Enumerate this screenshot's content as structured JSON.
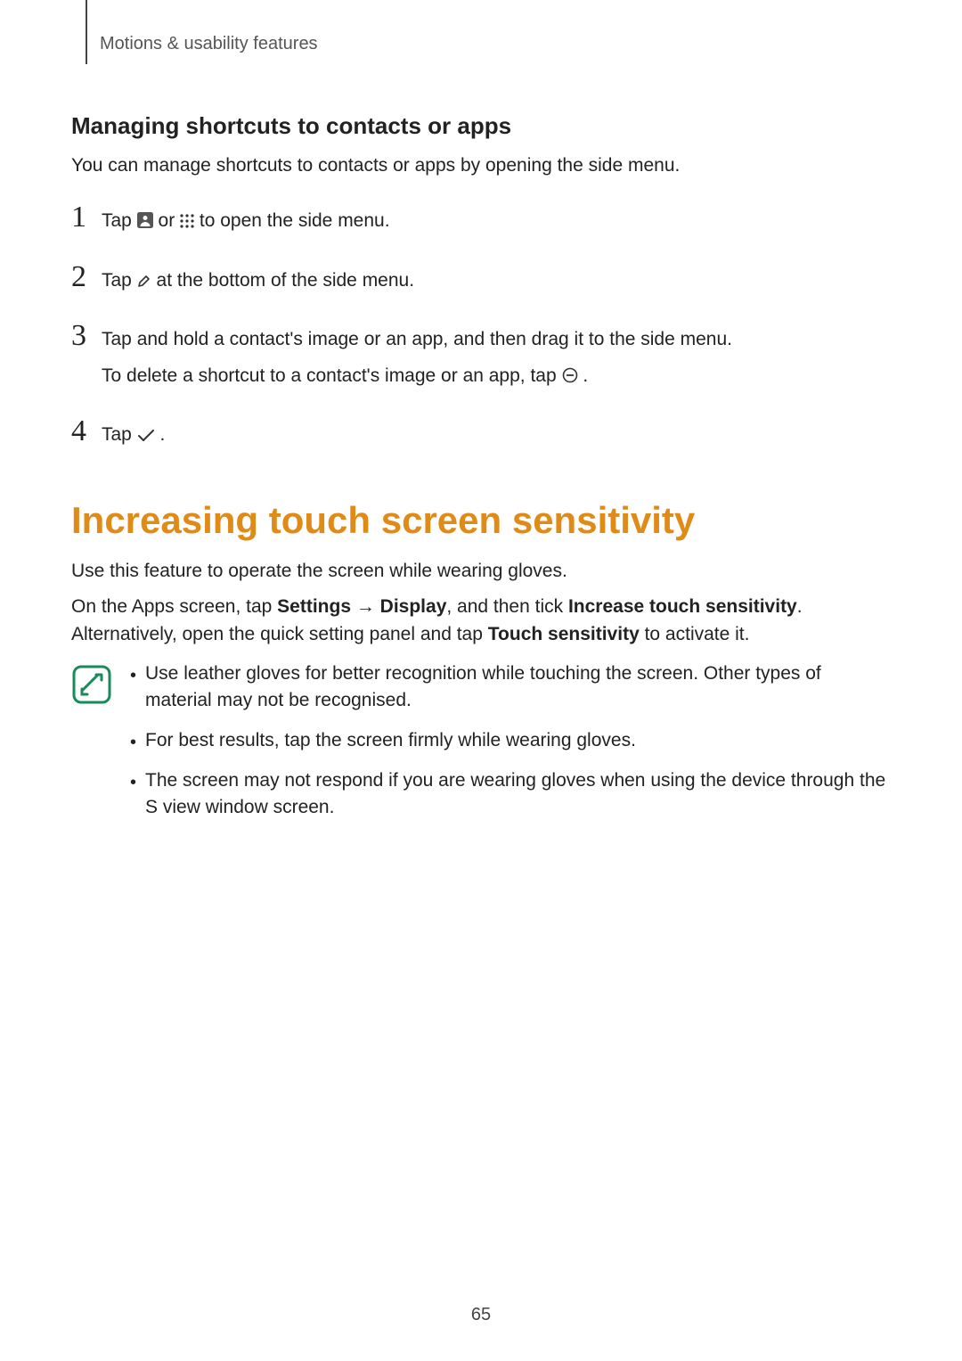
{
  "breadcrumb": "Motions & usability features",
  "section_heading": "Managing shortcuts to contacts or apps",
  "section_intro": "You can manage shortcuts to contacts or apps by opening the side menu.",
  "steps": {
    "n1": "1",
    "s1a": "Tap ",
    "s1b": " or ",
    "s1c": " to open the side menu.",
    "n2": "2",
    "s2a": "Tap ",
    "s2b": " at the bottom of the side menu.",
    "n3": "3",
    "s3a": "Tap and hold a contact's image or an app, and then drag it to the side menu.",
    "s3b": "To delete a shortcut to a contact's image or an app, tap ",
    "n4": "4",
    "s4a": "Tap ",
    "s4b": "."
  },
  "h1": "Increasing touch screen sensitivity",
  "p1": "Use this feature to operate the screen while wearing gloves.",
  "p2a": "On the Apps screen, tap ",
  "p2b": "Settings",
  "p2c": " → ",
  "p2d": "Display",
  "p2e": ", and then tick ",
  "p2f": "Increase touch sensitivity",
  "p2g": ". Alternatively, open the quick setting panel and tap ",
  "p2h": "Touch sensitivity",
  "p2i": " to activate it.",
  "tips": {
    "t1": "Use leather gloves for better recognition while touching the screen. Other types of material may not be recognised.",
    "t2": "For best results, tap the screen firmly while wearing gloves.",
    "t3": "The screen may not respond if you are wearing gloves when using the device through the S view window screen."
  },
  "page_number": "65"
}
